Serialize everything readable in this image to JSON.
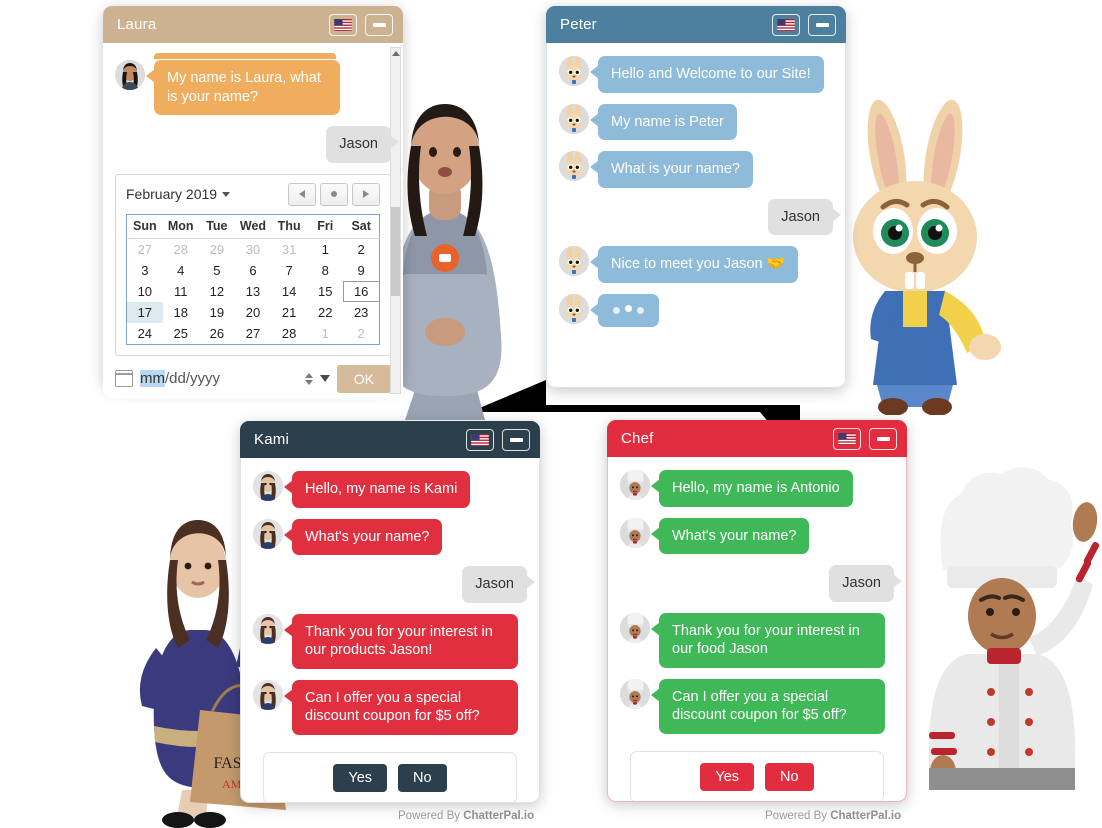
{
  "widgets": [
    {
      "id": "laura",
      "title": "Laura",
      "header_color": "#cdb292",
      "bubble_color": "#f0ad5e",
      "lang_icon": "us-flag-icon",
      "minimize_icon": "minimize-icon",
      "messages": [
        {
          "side": "bot",
          "text": "My name is Laura, what is your name?"
        },
        {
          "side": "user",
          "text": "Jason"
        }
      ],
      "datepicker": {
        "month_label": "February 2019",
        "nav_prev_icon": "chevron-left-icon",
        "nav_today_icon": "dot-icon",
        "nav_next_icon": "chevron-right-icon",
        "weekdays": [
          "Sun",
          "Mon",
          "Tue",
          "Wed",
          "Thu",
          "Fri",
          "Sat"
        ],
        "weeks": [
          [
            {
              "d": "27",
              "m": 1
            },
            {
              "d": "28",
              "m": 1
            },
            {
              "d": "29",
              "m": 1
            },
            {
              "d": "30",
              "m": 1
            },
            {
              "d": "31",
              "m": 1
            },
            {
              "d": "1"
            },
            {
              "d": "2"
            }
          ],
          [
            {
              "d": "3"
            },
            {
              "d": "4"
            },
            {
              "d": "5"
            },
            {
              "d": "6"
            },
            {
              "d": "7"
            },
            {
              "d": "8"
            },
            {
              "d": "9"
            }
          ],
          [
            {
              "d": "10"
            },
            {
              "d": "11"
            },
            {
              "d": "12"
            },
            {
              "d": "13"
            },
            {
              "d": "14"
            },
            {
              "d": "15"
            },
            {
              "d": "16",
              "b": 1
            }
          ],
          [
            {
              "d": "17",
              "s": 1
            },
            {
              "d": "18"
            },
            {
              "d": "19"
            },
            {
              "d": "20"
            },
            {
              "d": "21"
            },
            {
              "d": "22"
            },
            {
              "d": "23"
            }
          ],
          [
            {
              "d": "24"
            },
            {
              "d": "25"
            },
            {
              "d": "26"
            },
            {
              "d": "27"
            },
            {
              "d": "28"
            },
            {
              "d": "1",
              "m": 1
            },
            {
              "d": "2",
              "m": 1
            }
          ]
        ],
        "input_highlight": "mm",
        "input_rest": "/dd/yyyy",
        "ok_label": "OK"
      }
    },
    {
      "id": "peter",
      "title": "Peter",
      "header_color": "#4d7f9e",
      "bubble_color": "#8ebbd9",
      "lang_icon": "us-flag-icon",
      "minimize_icon": "minimize-icon",
      "messages": [
        {
          "side": "bot",
          "text": "Hello and Welcome to our Site!"
        },
        {
          "side": "bot",
          "text": "My name is Peter"
        },
        {
          "side": "bot",
          "text": "What is your name?"
        },
        {
          "side": "user",
          "text": "Jason"
        },
        {
          "side": "bot",
          "text": "Nice to meet you Jason 🤝"
        },
        {
          "side": "bot",
          "typing": true,
          "text": ""
        }
      ]
    },
    {
      "id": "kami",
      "title": "Kami",
      "header_color": "#2b3f4c",
      "bubble_color": "#e0303f",
      "lang_icon": "us-flag-icon",
      "minimize_icon": "minimize-icon",
      "messages": [
        {
          "side": "bot",
          "text": "Hello, my name is Kami"
        },
        {
          "side": "bot",
          "text": "What's your name?"
        },
        {
          "side": "user",
          "text": "Jason"
        },
        {
          "side": "bot",
          "text": "Thank you for your interest in our products Jason!"
        },
        {
          "side": "bot",
          "text": "Can I offer you a special discount coupon for $5 off?"
        }
      ],
      "quick_replies": [
        {
          "label": "Yes",
          "color": "#2b3f4c"
        },
        {
          "label": "No",
          "color": "#2b3f4c"
        }
      ],
      "powered_by_prefix": "Powered By ",
      "powered_by_brand": "ChatterPal.io"
    },
    {
      "id": "chef",
      "title": "Chef",
      "header_color": "#e12d3f",
      "bubble_color": "#3fb958",
      "lang_icon": "us-flag-icon",
      "minimize_icon": "minimize-icon",
      "messages": [
        {
          "side": "bot",
          "text": "Hello, my name is Antonio"
        },
        {
          "side": "bot",
          "text": "What's your name?"
        },
        {
          "side": "user",
          "text": "Jason"
        },
        {
          "side": "bot",
          "text": "Thank you for your interest in our food Jason"
        },
        {
          "side": "bot",
          "text": "Can I offer you a special discount coupon for $5 off?"
        }
      ],
      "quick_replies": [
        {
          "label": "Yes",
          "color": "#e12d3f"
        },
        {
          "label": "No",
          "color": "#e12d3f"
        }
      ],
      "powered_by_prefix": "Powered By ",
      "powered_by_brand": "ChatterPal.io"
    }
  ],
  "avatars": {
    "laura": "woman-in-grey-dress-avatar",
    "peter": "rabbit-mascot-avatar",
    "kami": "woman-with-shopping-bag-avatar",
    "chef": "chef-avatar"
  },
  "shopping_bag": {
    "line1": "FASHI",
    "line2": "AMOR"
  }
}
